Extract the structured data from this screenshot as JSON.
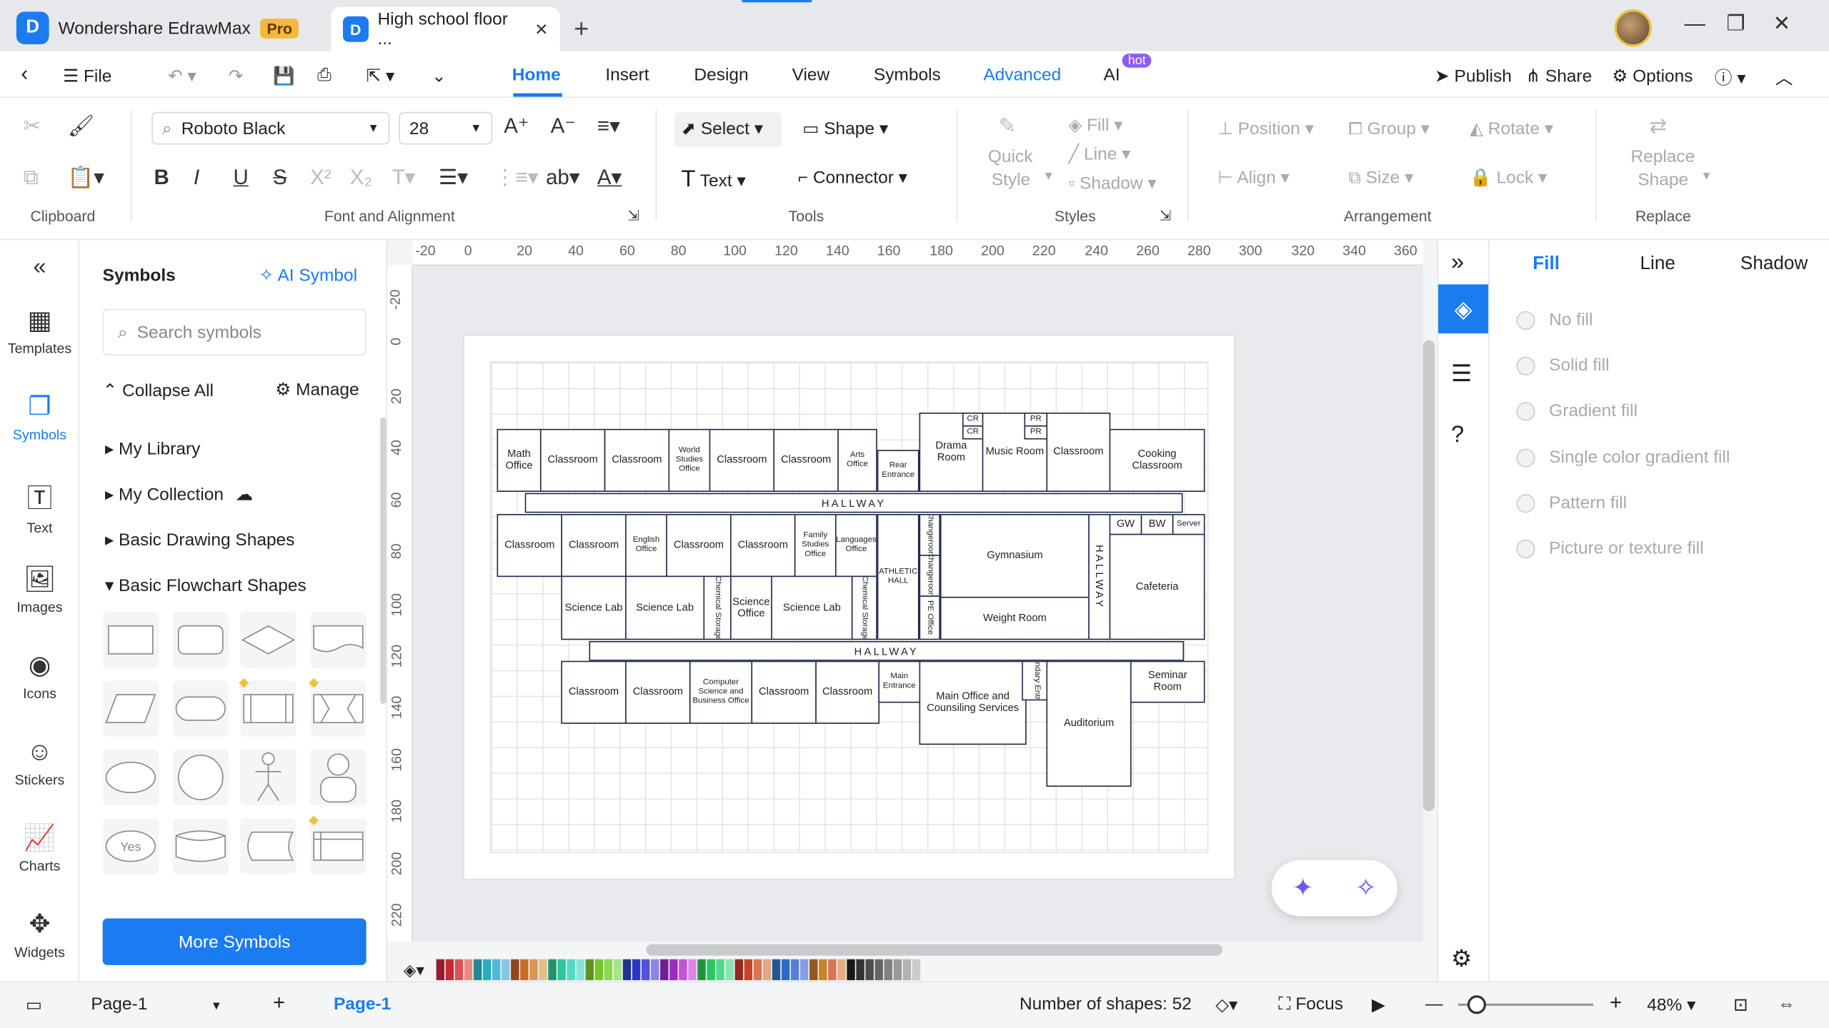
{
  "app": {
    "name": "Wondershare EdrawMax",
    "badge": "Pro",
    "doc_tab": "High school floor ..."
  },
  "menu": {
    "file": "File",
    "tabs": [
      "Home",
      "Insert",
      "Design",
      "View",
      "Symbols",
      "Advanced",
      "AI"
    ],
    "hot": "hot",
    "publish": "Publish",
    "share": "Share",
    "options": "Options"
  },
  "ribbon": {
    "font_name": "Roboto Black",
    "font_size": "28",
    "select": "Select",
    "shape": "Shape",
    "text": "Text",
    "connector": "Connector",
    "quick_style_1": "Quick",
    "quick_style_2": "Style",
    "fill": "Fill",
    "line": "Line",
    "shadow": "Shadow",
    "position": "Position",
    "group": "Group",
    "rotate": "Rotate",
    "align": "Align",
    "size": "Size",
    "lock": "Lock",
    "replace_shape_1": "Replace",
    "replace_shape_2": "Shape",
    "groups": {
      "clipboard": "Clipboard",
      "font": "Font and Alignment",
      "tools": "Tools",
      "styles": "Styles",
      "arrangement": "Arrangement",
      "replace": "Replace"
    }
  },
  "leftbar": [
    "Templates",
    "Symbols",
    "Text",
    "Images",
    "Icons",
    "Stickers",
    "Charts",
    "Widgets"
  ],
  "symbols": {
    "title": "Symbols",
    "ai_symbol": "AI Symbol",
    "search_placeholder": "Search symbols",
    "collapse_all": "Collapse All",
    "manage": "Manage",
    "libraries": [
      "My Library",
      "My Collection",
      "Basic Drawing Shapes",
      "Basic Flowchart Shapes"
    ],
    "yes_label": "Yes",
    "more": "More Symbols"
  },
  "ruler": {
    "h": [
      "-20",
      "0",
      "20",
      "40",
      "60",
      "80",
      "100",
      "120",
      "140",
      "160",
      "180",
      "200",
      "220",
      "240",
      "260",
      "280",
      "300",
      "320",
      "340",
      "360"
    ],
    "v": [
      "-20",
      "0",
      "20",
      "40",
      "60",
      "80",
      "100",
      "120",
      "140",
      "160",
      "180",
      "200",
      "220"
    ]
  },
  "floorplan": {
    "hall1": "HALLWAY",
    "hall2": "HALLWAY",
    "hall_v": "HALLWAY",
    "math_office": "Math Office",
    "classroom": "Classroom",
    "world_studies": "World Studies Office",
    "arts_office": "Arts Office",
    "rear_entrance": "Rear Entrance",
    "drama_room": "Drama Room",
    "cr": "CR",
    "music_room": "Music Room",
    "pr": "PR",
    "cooking_classroom": "Cooking Classroom",
    "english_office": "English Office",
    "family_studies": "Family Studies Office",
    "languages_office": "Languages Office",
    "athletic_hall": "ATHLETIC HALL",
    "changeroom": "Changeroom",
    "gymnasium": "Gymnasium",
    "gw": "GW",
    "bw": "BW",
    "server": "Server",
    "science_lab": "Science Lab",
    "chemical_storage": "Chemical Storage",
    "science_office": "Science Office",
    "pe_office": "PE Office",
    "weight_room": "Weight Room",
    "cafeteria": "Cafeteria",
    "computer_office": "Computer Science and Business Office",
    "main_entrance": "Main Entrance",
    "main_office": "Main Office and Counsiling Services",
    "secondary_entrance": "Secondary Entrance",
    "seminar_room": "Seminar Room",
    "auditorium": "Auditorium"
  },
  "rightpanel": {
    "tabs": [
      "Fill",
      "Line",
      "Shadow"
    ],
    "options": [
      "No fill",
      "Solid fill",
      "Gradient fill",
      "Single color gradient fill",
      "Pattern fill",
      "Picture or texture fill"
    ]
  },
  "status": {
    "page_select": "Page-1",
    "page_tab": "Page-1",
    "shapes": "Number of shapes: 52",
    "focus": "Focus",
    "zoom": "48%"
  },
  "colors": {
    "accent": "#1a7cf0",
    "room_border": "#1f2a4a"
  }
}
